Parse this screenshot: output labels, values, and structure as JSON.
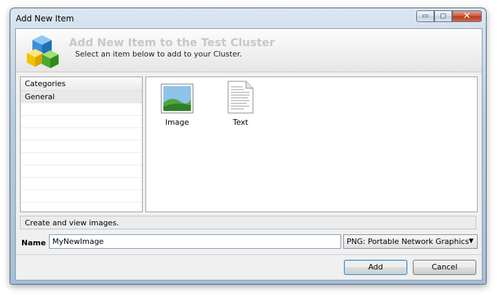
{
  "window": {
    "title": "Add New Item"
  },
  "caption": {
    "minimize_glyph": "▭",
    "maximize_glyph": "▢",
    "close_glyph": "✕"
  },
  "banner": {
    "title": "Add New Item to the Test Cluster",
    "subtitle": "Select an item below to add to your Cluster.",
    "icon": "cubes-icon"
  },
  "categories": {
    "header": "Categories",
    "items": [
      "General"
    ],
    "selected": "General"
  },
  "items": [
    {
      "label": "Image",
      "icon": "image-file-icon"
    },
    {
      "label": "Text",
      "icon": "text-file-icon"
    }
  ],
  "description": "Create and view images.",
  "name_field": {
    "label": "Name",
    "value": "MyNewImage"
  },
  "format": {
    "selected": "PNG: Portable Network Graphics",
    "arrow": "▼"
  },
  "buttons": {
    "add": "Add",
    "cancel": "Cancel"
  }
}
